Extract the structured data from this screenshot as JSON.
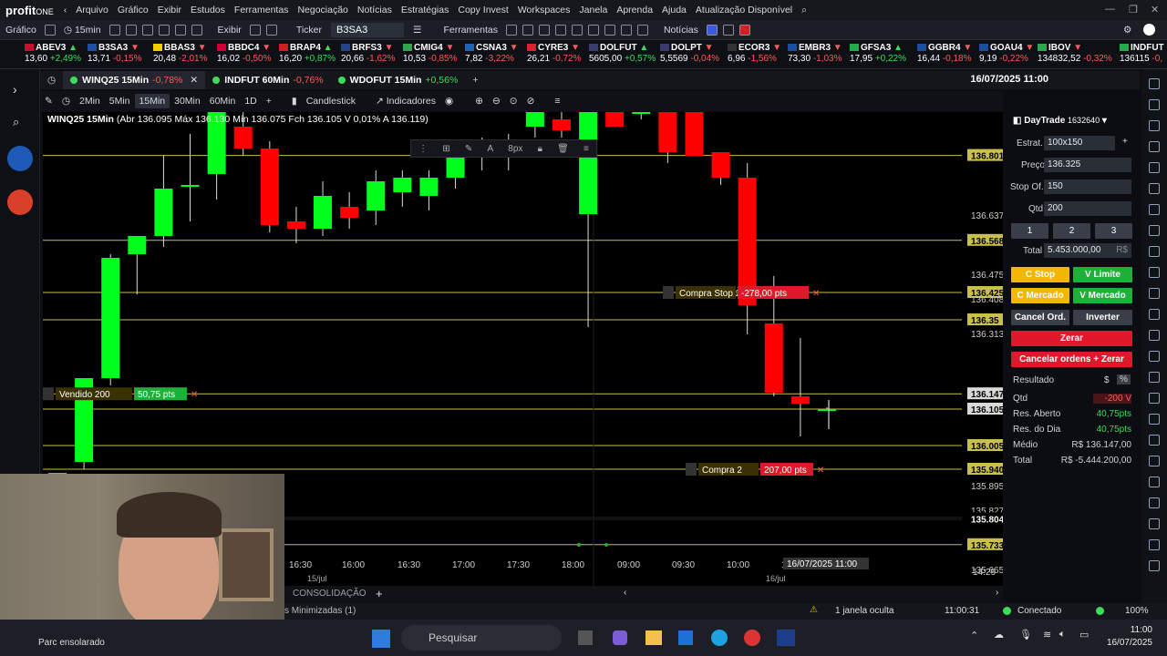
{
  "app": {
    "logo": "profit",
    "logo_suffix": "ONE"
  },
  "menu": [
    "Arquivo",
    "Gráfico",
    "Exibir",
    "Estudos",
    "Ferramentas",
    "Negociação",
    "Notícias",
    "Estratégias",
    "Copy Invest",
    "Workspaces",
    "Janela",
    "Aprenda",
    "Ajuda",
    "Atualização Disponível"
  ],
  "toolbar": {
    "grafico": "Gráfico",
    "interval": "15min",
    "exibir": "Exibir",
    "ticker_label": "Ticker",
    "ticker_value": "B3SA3",
    "ferramentas": "Ferramentas",
    "noticias": "Notícias"
  },
  "tape": [
    {
      "s": "ABEV3",
      "v": "13,60",
      "c": "+2,49%",
      "dir": "pos",
      "flag": "#c8102e"
    },
    {
      "s": "B3SA3",
      "v": "13,71",
      "c": "-0,15%",
      "dir": "neg",
      "flag": "#1f4ea3"
    },
    {
      "s": "BBAS3",
      "v": "20,48",
      "c": "-2,01%",
      "dir": "neg",
      "flag": "#f0d000"
    },
    {
      "s": "BBDC4",
      "v": "16,02",
      "c": "-0,50%",
      "dir": "neg",
      "flag": "#cc0033"
    },
    {
      "s": "BRAP4",
      "v": "16,20",
      "c": "+0,87%",
      "dir": "pos",
      "flag": "#cc2222"
    },
    {
      "s": "BRFS3",
      "v": "20,66",
      "c": "-1,62%",
      "dir": "neg",
      "flag": "#224488"
    },
    {
      "s": "CMIG4",
      "v": "10,53",
      "c": "-0,85%",
      "dir": "neg",
      "flag": "#2aa84a"
    },
    {
      "s": "CSNA3",
      "v": "7,82",
      "c": "-3,22%",
      "dir": "neg",
      "flag": "#1e63b5"
    },
    {
      "s": "CYRE3",
      "v": "26,21",
      "c": "-0,72%",
      "dir": "neg",
      "flag": "#d8232a"
    },
    {
      "s": "DOLFUT",
      "v": "5605,00",
      "c": "+0,57%",
      "dir": "pos",
      "flag": "#3c3b6e"
    },
    {
      "s": "DOLPT",
      "v": "5,5569",
      "c": "-0,04%",
      "dir": "neg",
      "flag": "#3c3b6e"
    },
    {
      "s": "ECOR3",
      "v": "6,96",
      "c": "-1,56%",
      "dir": "neg",
      "flag": "#333333"
    },
    {
      "s": "EMBR3",
      "v": "73,30",
      "c": "-1,03%",
      "dir": "neg",
      "flag": "#1a4fa0"
    },
    {
      "s": "GFSA3",
      "v": "17,95",
      "c": "+0,22%",
      "dir": "pos",
      "flag": "#2aa84a"
    },
    {
      "s": "GGBR4",
      "v": "16,44",
      "c": "-0,18%",
      "dir": "neg",
      "flag": "#1a4fa0"
    },
    {
      "s": "GOAU4",
      "v": "9,19",
      "c": "-0,22%",
      "dir": "neg",
      "flag": "#1a4fa0"
    },
    {
      "s": "IBOV",
      "v": "134832,52",
      "c": "-0,32%",
      "dir": "neg",
      "flag": "#2aa84a"
    },
    {
      "s": "INDFUT",
      "v": "136115",
      "c": "-0,",
      "dir": "neg",
      "flag": "#2aa84a"
    }
  ],
  "chart_tabs": [
    {
      "title": "WINQ25 15Min",
      "chg": "-0,78%",
      "dir": "neg"
    },
    {
      "title": "INDFUT 60Min",
      "chg": "-0,76%",
      "dir": "neg"
    },
    {
      "title": "WDOFUT 15Min",
      "chg": "+0,56%",
      "dir": "pos"
    }
  ],
  "chart_datetime": "16/07/2025 11:00",
  "chart_toolbar": {
    "tf": [
      "2Min",
      "5Min",
      "15Min",
      "30Min",
      "60Min",
      "1D"
    ],
    "active": "15Min",
    "style": "Candlestick",
    "indicators": "Indicadores"
  },
  "ohlc": {
    "symbol": "WINQ25 15Min",
    "text": "(Abr 136.095 Máx 136.130 Mín 136.075 Fch 136.105 V 0,01% A 136.119)"
  },
  "chart_data": {
    "type": "candlestick",
    "xticks": [
      "16:30",
      "16:00",
      "16:30",
      "17:00",
      "17:30",
      "18:00",
      "09:00",
      "09:30",
      "10:00",
      "10:"
    ],
    "date_labels": [
      "15/jul",
      "16/jul"
    ],
    "crosshair_time": "16/07/2025 11:00",
    "price_labels": [
      "136.801",
      "136.637",
      "136.568",
      "136.475",
      "136.425",
      "136.408",
      "136.35",
      "136.313",
      "136.147",
      "136.105",
      "136.005",
      "135.940",
      "135.895",
      "135.827",
      "135.804",
      "135.733",
      "135.665"
    ],
    "order_lines": [
      {
        "label": "Compra Stop 200",
        "pts": "-278,00 pts",
        "price": "136.425"
      },
      {
        "label": "Vendido 200",
        "pts": "50,75 pts",
        "price": "136.147"
      },
      {
        "label": "Compra 2",
        "pts": "207,00 pts",
        "price": "135.940"
      }
    ],
    "ylim": [
      135.62,
      136.92
    ],
    "candles": [
      {
        "o": 135.64,
        "h": 135.93,
        "l": 135.62,
        "c": 135.93
      },
      {
        "o": 135.96,
        "h": 136.19,
        "l": 135.94,
        "c": 136.19
      },
      {
        "o": 136.19,
        "h": 136.53,
        "l": 136.17,
        "c": 136.52
      },
      {
        "o": 136.53,
        "h": 136.58,
        "l": 136.42,
        "c": 136.58
      },
      {
        "o": 136.58,
        "h": 136.8,
        "l": 136.55,
        "c": 136.71
      },
      {
        "o": 136.72,
        "h": 136.86,
        "l": 136.62,
        "c": 136.72
      },
      {
        "o": 136.75,
        "h": 136.92,
        "l": 136.68,
        "c": 136.92
      },
      {
        "o": 136.88,
        "h": 136.92,
        "l": 136.8,
        "c": 136.82
      },
      {
        "o": 136.82,
        "h": 136.84,
        "l": 136.59,
        "c": 136.61
      },
      {
        "o": 136.62,
        "h": 136.66,
        "l": 136.56,
        "c": 136.6
      },
      {
        "o": 136.6,
        "h": 136.73,
        "l": 136.58,
        "c": 136.69
      },
      {
        "o": 136.66,
        "h": 136.7,
        "l": 136.6,
        "c": 136.63
      },
      {
        "o": 136.65,
        "h": 136.76,
        "l": 136.61,
        "c": 136.73
      },
      {
        "o": 136.7,
        "h": 136.76,
        "l": 136.66,
        "c": 136.74
      },
      {
        "o": 136.69,
        "h": 136.76,
        "l": 136.65,
        "c": 136.74
      },
      {
        "o": 136.74,
        "h": 136.82,
        "l": 136.71,
        "c": 136.81
      },
      {
        "o": 136.8,
        "h": 136.85,
        "l": 136.76,
        "c": 136.83
      },
      {
        "o": 136.8,
        "h": 136.86,
        "l": 136.76,
        "c": 136.8
      },
      {
        "o": 136.88,
        "h": 136.92,
        "l": 136.85,
        "c": 136.92
      },
      {
        "o": 136.9,
        "h": 136.92,
        "l": 136.85,
        "c": 136.87
      },
      {
        "o": 136.64,
        "h": 136.92,
        "l": 136.33,
        "c": 136.92
      },
      {
        "o": 136.92,
        "h": 136.92,
        "l": 136.88,
        "c": 136.88
      },
      {
        "o": 136.92,
        "h": 136.92,
        "l": 136.9,
        "c": 136.92
      },
      {
        "o": 136.92,
        "h": 136.92,
        "l": 136.78,
        "c": 136.81
      },
      {
        "o": 136.92,
        "h": 136.92,
        "l": 136.8,
        "c": 136.8
      },
      {
        "o": 136.81,
        "h": 136.81,
        "l": 136.72,
        "c": 136.74
      },
      {
        "o": 136.74,
        "h": 136.78,
        "l": 136.31,
        "c": 136.39
      },
      {
        "o": 136.34,
        "h": 136.47,
        "l": 136.14,
        "c": 136.15
      },
      {
        "o": 136.14,
        "h": 136.3,
        "l": 136.03,
        "c": 136.12
      },
      {
        "o": 136.1,
        "h": 136.11,
        "l": 136.1,
        "c": 136.105
      }
    ]
  },
  "right_panel": {
    "account_label": "DayTrade",
    "account_id": "1632640",
    "estrat_label": "Estrat.",
    "estrat_value": "100x150",
    "preco_label": "Preço",
    "preco_value": "136.325",
    "stop_label": "Stop Of.",
    "stop_value": "150",
    "qtd_label": "Qtd",
    "qtd_value": "200",
    "presets": [
      "1",
      "2",
      "3"
    ],
    "total_label": "Total",
    "total_value": "5.453.000,00",
    "total_unit": "R$",
    "buttons": {
      "c_stop": "C Stop",
      "v_limite": "V Limite",
      "c_mercado": "C Mercado",
      "v_mercado": "V Mercado",
      "cancel": "Cancel Ord.",
      "inverter": "Inverter",
      "zerar": "Zerar",
      "cancelar_zerar": "Cancelar ordens + Zerar"
    },
    "resultado_label": "Resultado",
    "resultado_unit": "$",
    "stats": [
      {
        "k": "Qtd",
        "v": "-200 V",
        "color": "#ff5a5a"
      },
      {
        "k": "Res. Aberto",
        "v": "40,75pts",
        "color": "#3ddc5a"
      },
      {
        "k": "Res. do Dia",
        "v": "40,75pts",
        "color": "#3ddc5a"
      },
      {
        "k": "Médio",
        "v": "R$ 136.147,00",
        "color": "#cfd3da"
      },
      {
        "k": "Total",
        "v": "R$ -5.444.200,00",
        "color": "#cfd3da"
      }
    ]
  },
  "status": {
    "consolidacao": "CONSOLIDAÇÃO",
    "min": "s Minimizadas (1)",
    "hidden": "1 janela oculta",
    "time": "11:00:31",
    "conn": "Conectado",
    "zoom": "100%",
    "axis_time": "14:29"
  },
  "taskbar": {
    "search": "Pesquisar",
    "weather": "Parc ensolarado",
    "clock_time": "11:00",
    "clock_date": "16/07/2025"
  },
  "colors": {
    "up": "#00ff1a",
    "down": "#ff0000",
    "level": "#c8c04a",
    "buy_btn": "#f0b800",
    "sell_btn": "#1fb03a",
    "red_btn": "#e0182b"
  }
}
